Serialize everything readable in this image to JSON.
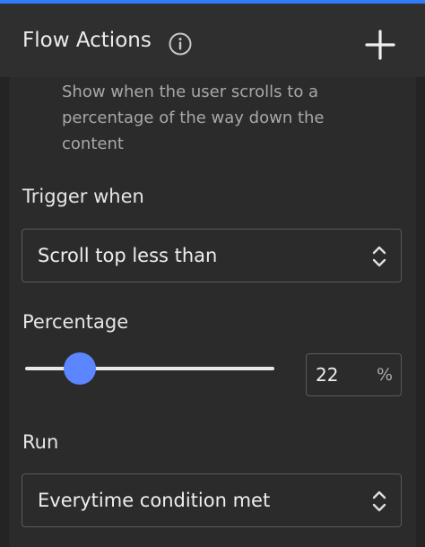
{
  "panel": {
    "title": "Flow Actions",
    "icons": {
      "info": "info-circle-icon",
      "add": "plus-icon"
    },
    "accent_color": "#2f7cf6"
  },
  "description": {
    "lines": [
      "Show when the user scrolls to a",
      "percentage of the way down the",
      "content"
    ]
  },
  "trigger": {
    "label": "Trigger when",
    "value": "Scroll top less than",
    "icon": "chevron-up-down-icon"
  },
  "percentage": {
    "label": "Percentage",
    "value": "22",
    "unit": "%",
    "slider_fraction": 0.22,
    "thumb_color": "#5c86ff"
  },
  "run": {
    "label": "Run",
    "value": "Everytime condition met",
    "icon": "chevron-up-down-icon"
  }
}
